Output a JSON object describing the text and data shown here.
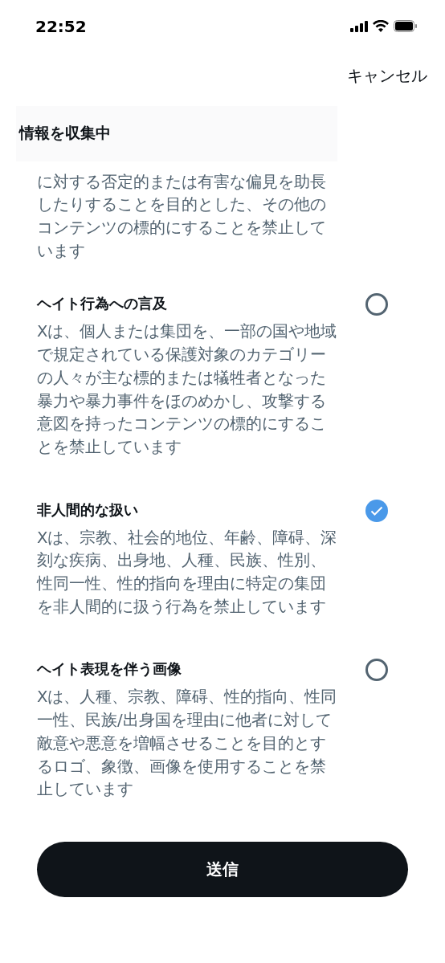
{
  "status_bar": {
    "time": "22:52"
  },
  "cancel": "キャンセル",
  "header": {
    "title": "情報を収集中"
  },
  "options": [
    {
      "kind": "partial",
      "description": "に対する否定的または有害な偏見を助長したりすることを目的とした、その他のコンテンツの標的にすることを禁止しています"
    },
    {
      "kind": "option",
      "title": "ヘイト行為への言及",
      "description": "Xは、個人または集団を、一部の国や地域で規定されている保護対象のカテゴリーの人々が主な標的または犠牲者となった暴力や暴力事件をほのめかし、攻撃する意図を持ったコンテンツの標的にすることを禁止しています",
      "selected": false
    },
    {
      "kind": "option",
      "title": "非人間的な扱い",
      "description": "Xは、宗教、社会的地位、年齢、障碍、深刻な疾病、出身地、人種、民族、性別、性同一性、性的指向を理由に特定の集団を非人間的に扱う行為を禁止しています",
      "selected": true
    },
    {
      "kind": "option",
      "title": "ヘイト表現を伴う画像",
      "description": "Xは、人種、宗教、障碍、性的指向、性同一性、民族/出身国を理由に他者に対して敵意や悪意を増幅させることを目的とするロゴ、象徴、画像を使用することを禁止しています",
      "selected": false
    }
  ],
  "submit": "送信"
}
